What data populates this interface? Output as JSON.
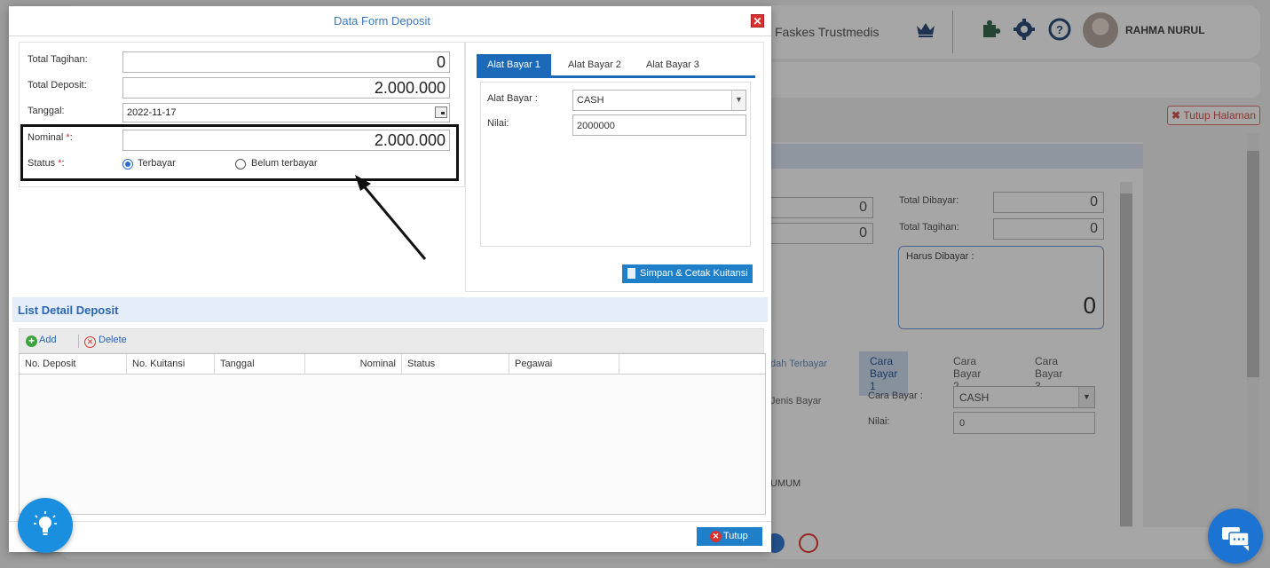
{
  "background": {
    "facility_name": "Faskes Trustmedis",
    "user_name": "RAHMA NURUL",
    "close_page_label": "Tutup Halaman",
    "total_dibayar_label": "Total Dibayar:",
    "total_dibayar_value": "0",
    "total_tagihan_label": "Total Tagihan:",
    "total_tagihan_value": "0",
    "left_values": [
      "0",
      "0"
    ],
    "harus_dibayar_label": "Harus Dibayar :",
    "harus_dibayar_value": "0",
    "tabs": [
      "Cara Bayar 1",
      "Cara Bayar 2",
      "Cara Bayar 3"
    ],
    "cara_bayar_label": "Cara Bayar :",
    "cara_bayar_value": "CASH",
    "nilai_label": "Nilai:",
    "nilai_value": "0",
    "sudah_terbayar": "dah Terbayar",
    "jenis_bayar": "Jenis Bayar",
    "umum": "UMUM"
  },
  "modal": {
    "title": "Data Form Deposit",
    "close_symbol": "✕",
    "form": {
      "total_tagihan": {
        "label": "Total Tagihan:",
        "value": "0"
      },
      "total_deposit": {
        "label": "Total Deposit:",
        "value": "2.000.000"
      },
      "tanggal": {
        "label": "Tanggal:",
        "value": "2022-11-17"
      },
      "nominal": {
        "label": "Nominal ",
        "required": "*",
        "suffix": ":",
        "value": "2.000.000"
      },
      "status": {
        "label": "Status ",
        "required": "*",
        "suffix": ":",
        "options": [
          "Terbayar",
          "Belum terbayar"
        ],
        "selected": "Terbayar"
      }
    },
    "payment": {
      "tabs": [
        "Alat Bayar 1",
        "Alat Bayar 2",
        "Alat Bayar 3"
      ],
      "alat_bayar_label": "Alat Bayar :",
      "alat_bayar_value": "CASH",
      "nilai_label": "Nilai:",
      "nilai_value": "2000000",
      "save_print_label": "Simpan & Cetak Kuitansi"
    },
    "list": {
      "title": "List Detail Deposit",
      "add_label": "Add",
      "delete_label": "Delete",
      "columns": [
        "No. Deposit",
        "No. Kuitansi",
        "Tanggal",
        "Nominal",
        "Status",
        "Pegawai",
        ""
      ]
    },
    "close_button_label": "Tutup"
  },
  "colors": {
    "accent": "#1c69b8",
    "title_blue": "#3a78c2",
    "danger": "#d9322e"
  }
}
